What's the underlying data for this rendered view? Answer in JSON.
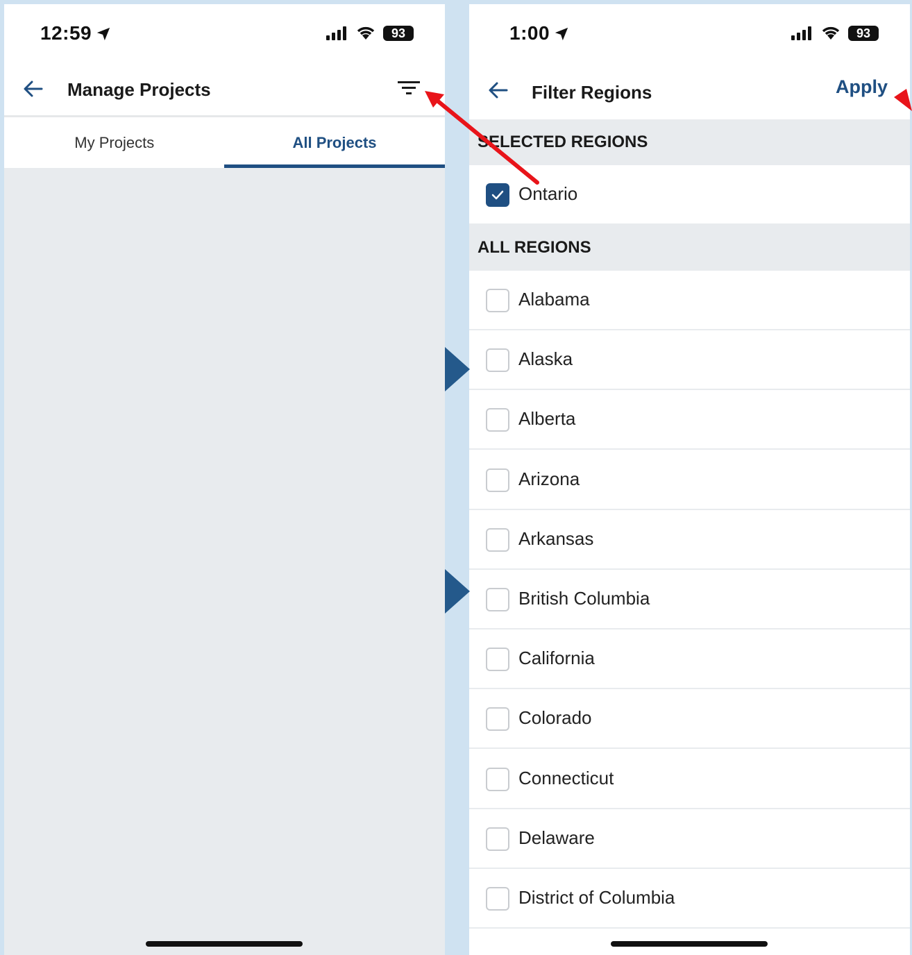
{
  "left": {
    "status": {
      "time": "12:59",
      "battery": "93"
    },
    "nav": {
      "title": "Manage Projects",
      "back_icon": "arrow-left-icon",
      "filter_icon": "filter-icon"
    },
    "tabs": [
      {
        "label": "My Projects",
        "active": false
      },
      {
        "label": "All Projects",
        "active": true
      }
    ]
  },
  "right": {
    "status": {
      "time": "1:00",
      "battery": "93"
    },
    "nav": {
      "title": "Filter Regions",
      "apply_label": "Apply",
      "back_icon": "arrow-left-icon"
    },
    "selected_header": "SELECTED REGIONS",
    "selected": [
      {
        "label": "Ontario",
        "checked": true
      }
    ],
    "all_header": "ALL REGIONS",
    "regions": [
      {
        "label": "Alabama",
        "checked": false
      },
      {
        "label": "Alaska",
        "checked": false
      },
      {
        "label": "Alberta",
        "checked": false
      },
      {
        "label": "Arizona",
        "checked": false
      },
      {
        "label": "Arkansas",
        "checked": false
      },
      {
        "label": "British Columbia",
        "checked": false
      },
      {
        "label": "California",
        "checked": false
      },
      {
        "label": "Colorado",
        "checked": false
      },
      {
        "label": "Connecticut",
        "checked": false
      },
      {
        "label": "Delaware",
        "checked": false
      },
      {
        "label": "District of Columbia",
        "checked": false
      }
    ]
  },
  "colors": {
    "accent": "#1f4f82",
    "annotation_arrow": "#e8141a",
    "step_marker": "#24598b",
    "panel_bg": "#e8ebee"
  }
}
